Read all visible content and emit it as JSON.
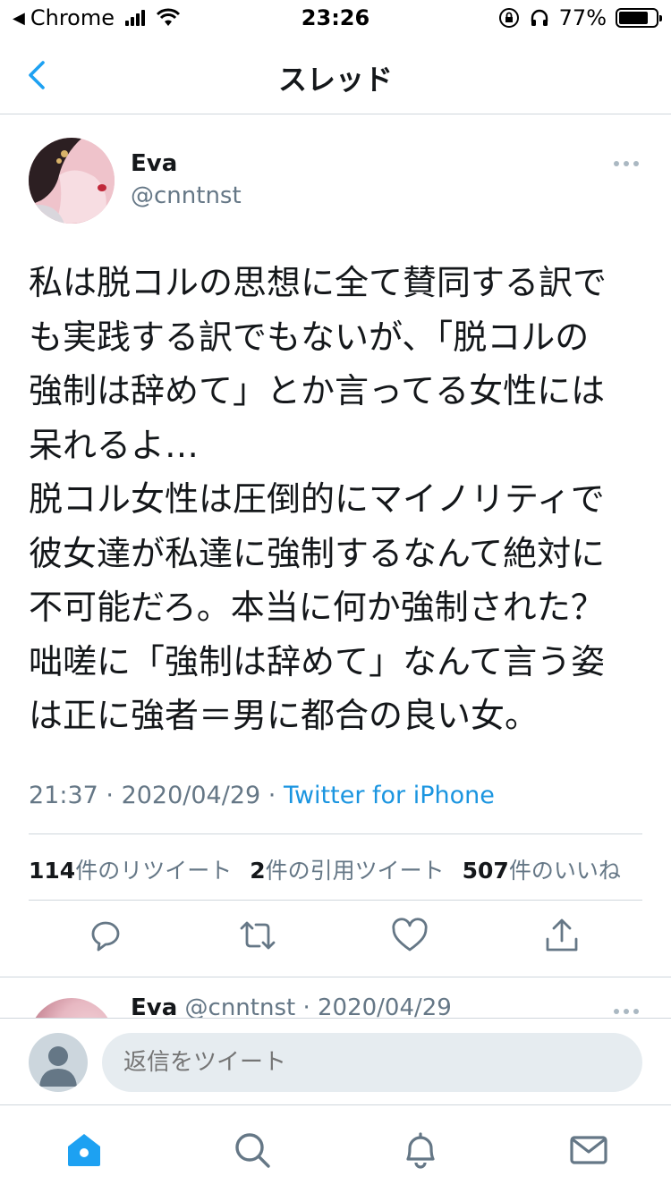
{
  "status_bar": {
    "back_app": "Chrome",
    "time": "23:26",
    "battery": "77%"
  },
  "nav": {
    "title": "スレッド",
    "back_icon": "chevron-left-icon"
  },
  "tweet": {
    "author_name": "Eva",
    "author_handle": "@cnntnst",
    "text": "私は脱コルの思想に全て賛同する訳で\nも実践する訳でもないが、「脱コルの\n強制は辞めて」とか言ってる女性には\n呆れるよ…\n脱コル女性は圧倒的にマイノリティで\n彼女達が私達に強制するなんて絶対に\n不可能だろ。本当に何か強制された？\n咄嗟に「強制は辞めて」なんて言う姿\nは正に強者＝男に都合の良い女。",
    "time": "21:37",
    "date": "2020/04/29",
    "separator": " · ",
    "source": "Twitter for iPhone",
    "stats": {
      "retweets_count": "114",
      "retweets_label": "件のリツイート",
      "quotes_count": "2",
      "quotes_label": "件の引用ツイート",
      "likes_count": "507",
      "likes_label": "件のいいね"
    },
    "actions": [
      "reply-icon",
      "retweet-icon",
      "like-icon",
      "share-icon"
    ]
  },
  "next_tweet": {
    "author_name": "Eva",
    "meta": " @cnntnst · 2020/04/29"
  },
  "reply": {
    "placeholder": "返信をツイート"
  },
  "tabbar": {
    "tabs": [
      "home-icon",
      "search-icon",
      "notifications-icon",
      "messages-icon"
    ]
  },
  "colors": {
    "accent": "#1da1f2",
    "source_link": "#1b95e0",
    "secondary_text": "#657786",
    "icon_gray": "#657786"
  }
}
